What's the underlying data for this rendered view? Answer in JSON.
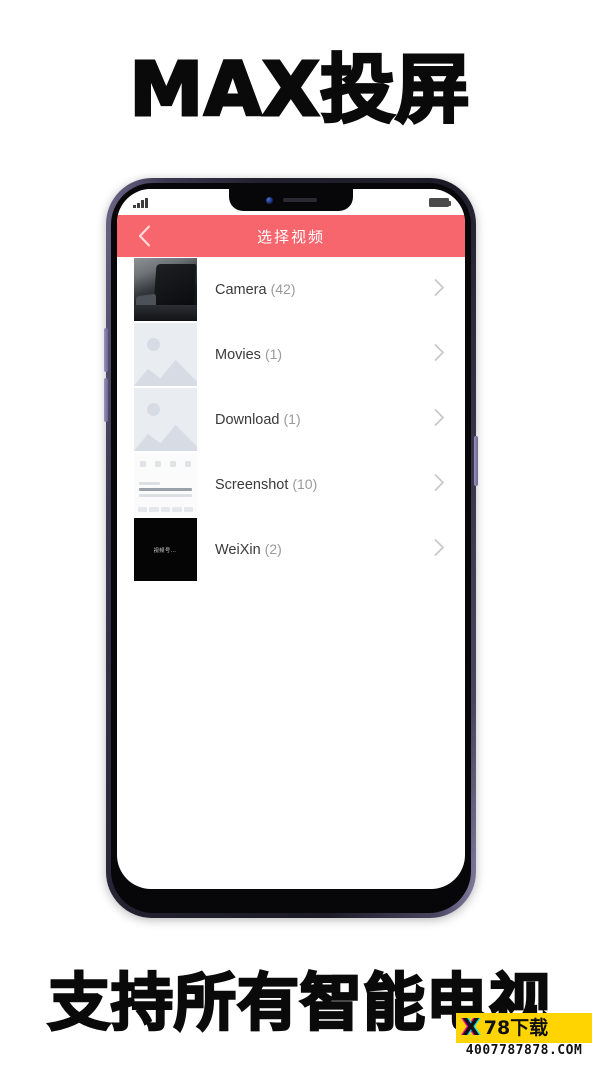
{
  "promo": {
    "top_text": "MAX投屏",
    "bottom_text": "支持所有智能电视"
  },
  "phone": {
    "status_bar": {
      "signal_icon": "signal-bars-icon",
      "battery_icon": "battery-icon",
      "front_camera_icon": "front-camera-icon",
      "earpiece_icon": "earpiece-speaker-icon"
    },
    "app_header": {
      "back_icon": "back-chevron-icon",
      "title": "选择视频",
      "background_color": "#f7656d",
      "title_color": "#ffffff"
    },
    "folder_list": [
      {
        "name": "Camera",
        "count": "(42)",
        "thumbnail": "camera-photo-thumbnail",
        "chevron_icon": "chevron-right-icon"
      },
      {
        "name": "Movies",
        "count": "(1)",
        "thumbnail": "placeholder-image-thumbnail",
        "chevron_icon": "chevron-right-icon"
      },
      {
        "name": "Download",
        "count": "(1)",
        "thumbnail": "placeholder-image-thumbnail",
        "chevron_icon": "chevron-right-icon"
      },
      {
        "name": "Screenshot",
        "count": "(10)",
        "thumbnail": "screenshot-thumbnail",
        "chevron_icon": "chevron-right-icon"
      },
      {
        "name": "WeiXin",
        "count": "(2)",
        "thumbnail": "weixin-video-thumbnail",
        "thumbnail_caption": "视频号…",
        "chevron_icon": "chevron-right-icon"
      }
    ],
    "side_buttons": {
      "volume_up": "volume-up-button",
      "volume_down": "volume-down-button",
      "power": "power-button"
    }
  },
  "watermark": {
    "mark": "X",
    "label": "78下载",
    "url": "4007787878.COM",
    "badge_color": "#ffd400"
  }
}
